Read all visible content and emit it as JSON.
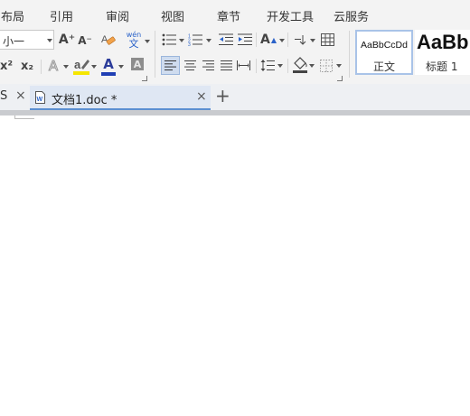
{
  "menu": {
    "items": [
      "布局",
      "引用",
      "审阅",
      "视图",
      "章节",
      "开发工具",
      "云服务"
    ]
  },
  "ribbon": {
    "font_size": "小一",
    "grow_font_glyph": "A⁺",
    "shrink_font_glyph": "A⁻",
    "pinyin_glyph_top": "wén",
    "pinyin_glyph_bottom": "文",
    "superscript_glyph": "x²",
    "subscript_glyph": "x₂",
    "font_color_glyph": "A",
    "char_shading_glyph": "A",
    "text_effect_glyph": "A",
    "text_direction_glyph": "A",
    "styles": [
      {
        "preview": "AaBbCcDd",
        "name": "正文"
      },
      {
        "preview": "AaBb",
        "name": "标题 1"
      }
    ]
  },
  "tabs": {
    "prev_tab_fragment": "S",
    "active_tab_title": "文档1.doc *",
    "close_glyph": "×",
    "new_tab_glyph": "+"
  },
  "colors": {
    "toolbar_bg": "#f3f3f3",
    "accent_blue": "#5b8fd1",
    "active_tab_bg": "#dfe7f3",
    "highlight_yellow": "#f5e600",
    "font_color_bar": "#1f3fb4"
  }
}
